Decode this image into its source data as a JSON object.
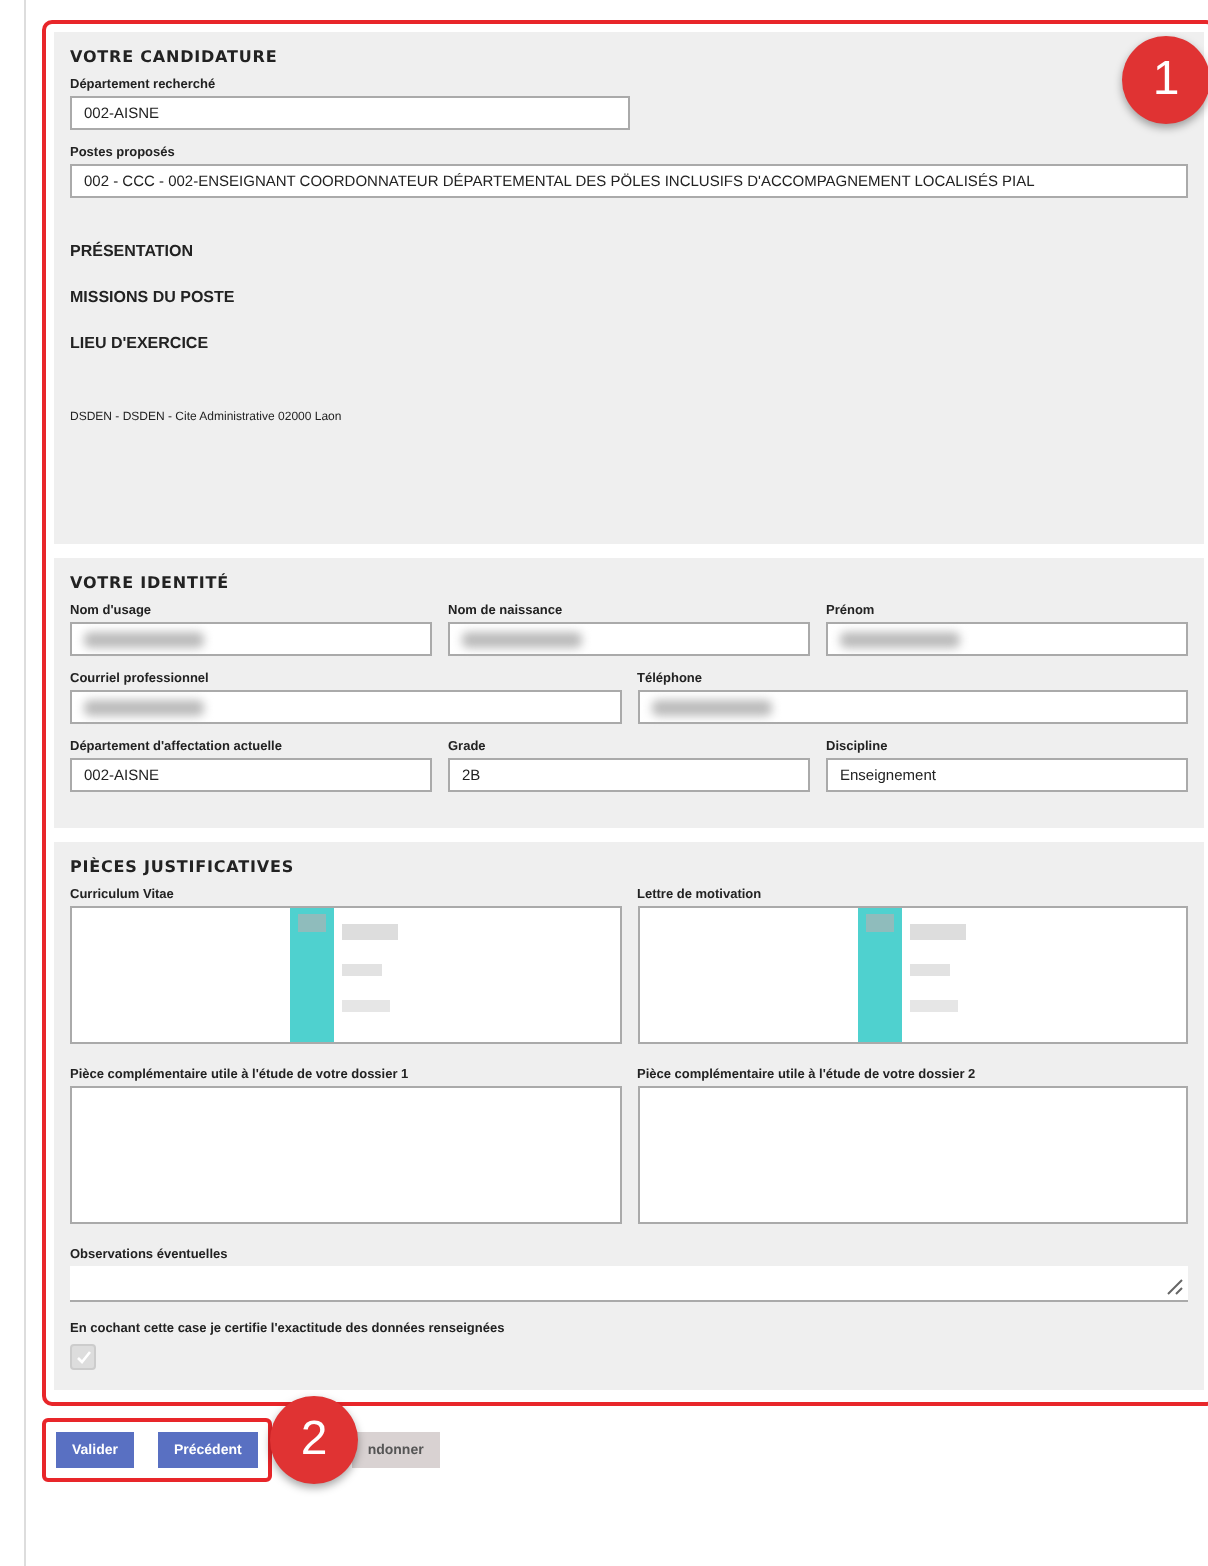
{
  "annotations": [
    {
      "label": "1"
    },
    {
      "label": "2"
    }
  ],
  "sections": [
    {
      "kind": "candidature",
      "title": "VOTRE CANDIDATURE",
      "fields": [
        {
          "label": "Département recherché",
          "value": "002-AISNE"
        },
        {
          "label": "Postes proposés",
          "value": "002 - CCC - 002-ENSEIGNANT COORDONNATEUR DÉPARTEMENTAL DES PÖLES INCLUSIFS D'ACCOMPAGNEMENT LOCALISÉS PIAL"
        }
      ],
      "subheadings": [
        "PRÉSENTATION",
        "MISSIONS DU POSTE",
        "LIEU D'EXERCICE"
      ],
      "address": "DSDEN - DSDEN - Cite Administrative 02000 Laon"
    },
    {
      "kind": "identity",
      "title": "VOTRE IDENTITÉ",
      "rows": [
        [
          {
            "label": "Nom d'usage",
            "masked": true
          },
          {
            "label": "Nom de naissance",
            "masked": true
          },
          {
            "label": "Prénom",
            "masked": true
          }
        ],
        [
          {
            "label": "Courriel professionnel",
            "masked": true
          },
          {
            "label": "Téléphone",
            "masked": true
          }
        ],
        [
          {
            "label": "Département d'affectation actuelle",
            "masked": false,
            "value": "002-AISNE"
          },
          {
            "label": "Grade",
            "masked": false,
            "value": "2B"
          },
          {
            "label": "Discipline",
            "masked": false,
            "value": "Enseignement"
          }
        ]
      ]
    },
    {
      "kind": "documents",
      "title": "PIÈCES JUSTIFICATIVES",
      "files": [
        {
          "label": "Curriculum Vitae",
          "preview": true
        },
        {
          "label": "Lettre de motivation",
          "preview": true
        },
        {
          "label": "Pièce complémentaire utile à l'étude de votre dossier 1",
          "preview": false
        },
        {
          "label": "Pièce complémentaire utile à l'étude de votre dossier 2",
          "preview": false
        }
      ],
      "observations": {
        "label": "Observations éventuelles"
      },
      "certify": {
        "label": "En cochant cette case je certifie l'exactitude des données renseignées",
        "checked": true,
        "disabled": true
      }
    }
  ],
  "buttons": [
    {
      "label": "Valider",
      "kind": "primary"
    },
    {
      "label": "Précédent",
      "kind": "primary"
    },
    {
      "label": "ndonner",
      "kind": "secondary"
    }
  ]
}
